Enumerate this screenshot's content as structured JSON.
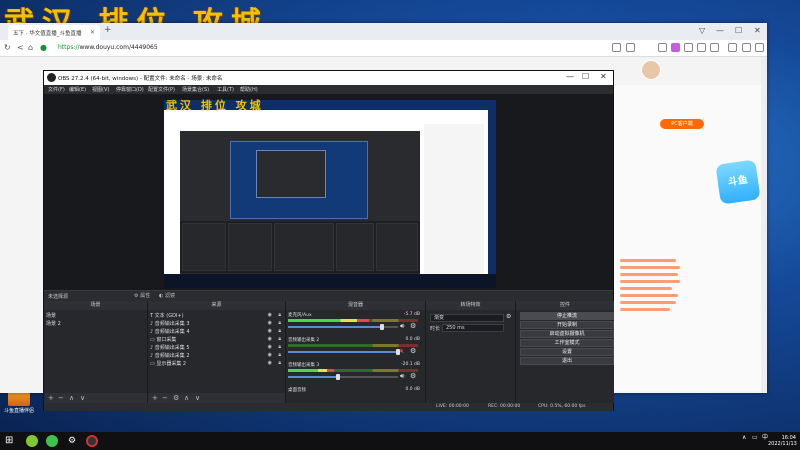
{
  "overlay_title": "武汉 排位 攻城",
  "desktop_icon_label": "斗鱼直播伴侣",
  "browser": {
    "tab_title": "五下 · 华文值直播_斗鱼直播",
    "url_prefix": "https://",
    "url_rest": "www.douyu.com/4449065",
    "pc_button": "PC客户端",
    "mascot_text": "斗鱼"
  },
  "obs": {
    "title": "OBS 27.2.4 (64-bit, windows) - 配置文件: 未命名 - 场景: 未命名",
    "menu": [
      "文件(F)",
      "编辑(E)",
      "视图(V)",
      "停靠窗口(D)",
      "配置文件(P)",
      "场景集合(S)",
      "工具(T)",
      "帮助(H)"
    ],
    "preview_title": "武汉 排位 攻城",
    "status_row": {
      "source_label": "未选择源",
      "properties": "属性",
      "filters": "滤镜"
    },
    "docks": {
      "scenes": {
        "title": "场景",
        "items": [
          "场景",
          "场景 2"
        ]
      },
      "sources": {
        "title": "来源",
        "items": [
          {
            "icon": "T",
            "name": "文本 (GDI+)"
          },
          {
            "icon": "♪",
            "name": "音频输出采集 3"
          },
          {
            "icon": "♪",
            "name": "音频输出采集 4"
          },
          {
            "icon": "▭",
            "name": "窗口采集"
          },
          {
            "icon": "♪",
            "name": "音频输出采集 5"
          },
          {
            "icon": "♪",
            "name": "音频输出采集 2"
          },
          {
            "icon": "▭",
            "name": "显示器采集 2"
          }
        ]
      },
      "mixer": {
        "title": "混音器",
        "channels": [
          {
            "name": "麦克风/Aux",
            "db": "-5.7 dB",
            "level": 0.62,
            "volume": 0.85
          },
          {
            "name": "音频输出采集 2",
            "db": "0.0 dB",
            "level": 0.0,
            "volume": 1.0
          },
          {
            "name": "音频输出采集 3",
            "db": "-20.1 dB",
            "level": 0.35,
            "volume": 0.45
          },
          {
            "name": "桌面音频",
            "db": "0.0 dB",
            "level": 0.0,
            "volume": 1.0
          }
        ]
      },
      "transitions": {
        "title": "转场特效",
        "type": "渐变",
        "duration_label": "时长",
        "duration": "250 ms"
      },
      "controls": {
        "title": "控件",
        "buttons": [
          "停止推流",
          "开始录制",
          "启动虚拟摄像机",
          "工作室模式",
          "设置",
          "退出"
        ]
      }
    },
    "statusbar": {
      "dropped": "LIVE: 00:00:00",
      "rec": "REC: 00:00:00",
      "cpu": "CPU: 0.5%, 60.00 fps"
    }
  },
  "taskbar": {
    "time": "16:04",
    "date": "2022/11/13",
    "tray_lang": "中"
  }
}
